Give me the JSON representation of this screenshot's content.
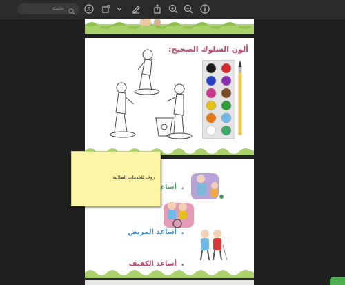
{
  "toolbar": {
    "search_placeholder": "بحث",
    "icons": [
      "info-icon",
      "zoom-in-icon",
      "zoom-out-icon",
      "share-icon",
      "markup-pen-icon",
      "chevron-down-icon",
      "rotate-icon",
      "annotate-icon",
      "search-icon"
    ]
  },
  "page2": {
    "title": "ألون السلوك الصحيح:"
  },
  "page3": {
    "activities": [
      {
        "label": "أساعد الكبير",
        "color": "#3f9e62"
      },
      {
        "label": "أساعد المريض",
        "color": "#3b86c6"
      },
      {
        "label": "أساعد الكفيف",
        "color": "#c0436b"
      }
    ]
  },
  "sticky_note": {
    "text": "روف للخدمات الطلابية"
  },
  "colors": {
    "paints": [
      "#1a1a1a",
      "#d42a2a",
      "#2a3fc2",
      "#8a2fb0",
      "#c73a8d",
      "#7a4a20",
      "#e5c21a",
      "#2c9e3a",
      "#e07b1a",
      "#6fb8e8",
      "#ffffff",
      "#3da66a"
    ]
  }
}
